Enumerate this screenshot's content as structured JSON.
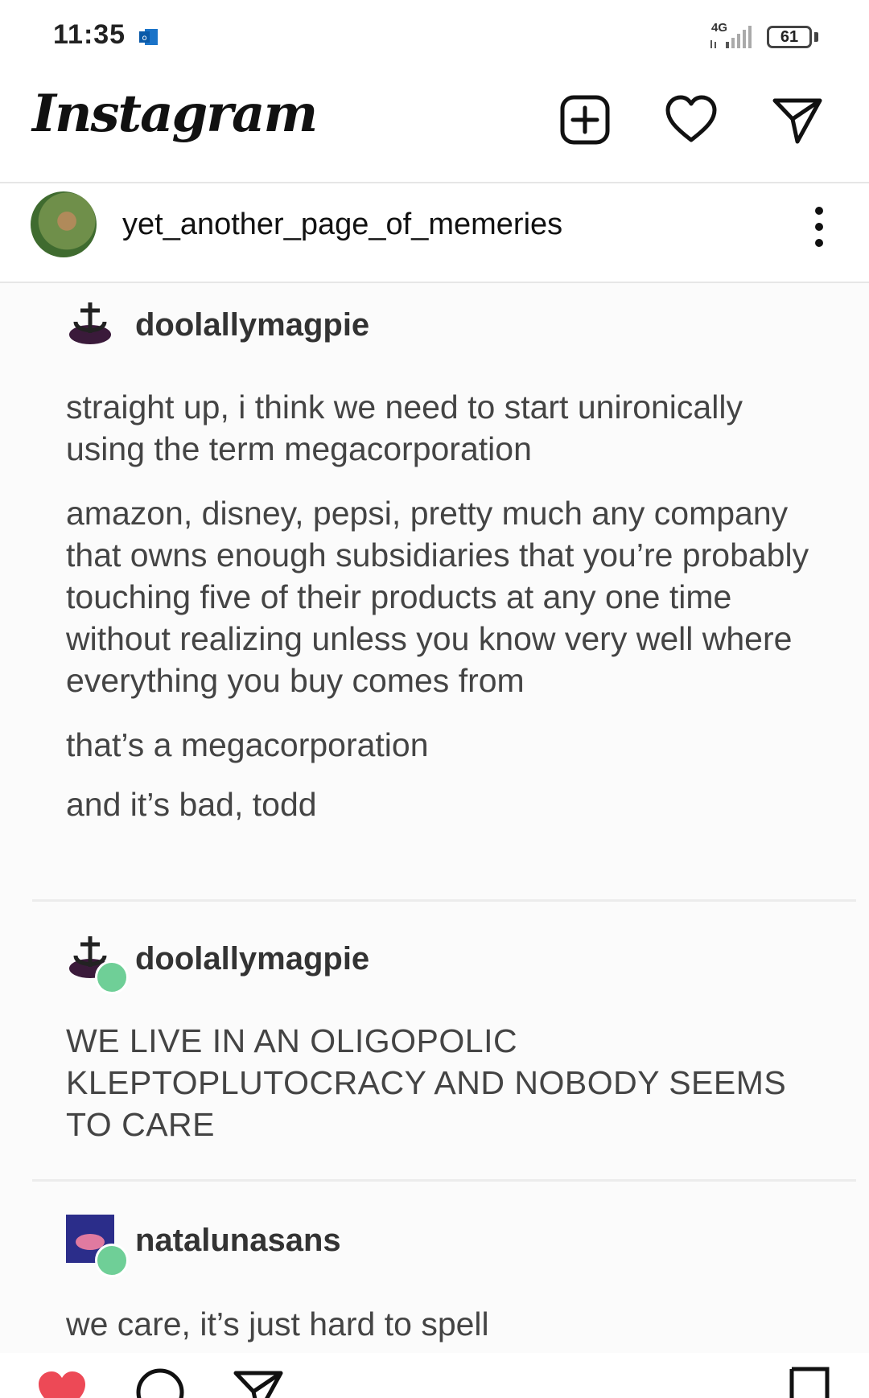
{
  "status": {
    "time": "11:35",
    "network": "4G",
    "battery": "61"
  },
  "header": {
    "logo": "Instagram",
    "icons": [
      "add-post-icon",
      "heart-icon",
      "direct-message-icon"
    ]
  },
  "post": {
    "username": "yet_another_page_of_memeries",
    "tumblr_blocks": [
      {
        "username": "doolallymagpie",
        "paragraphs": [
          "straight up, i think we need to start unironically using the term megacorporation",
          "amazon, disney, pepsi, pretty much any company that owns enough subsidiaries that you’re probably touching five of their products at any one time without realizing unless you know very well where everything you buy comes from",
          "that’s a megacorporation",
          "and it’s bad, todd"
        ]
      },
      {
        "username": "doolallymagpie",
        "paragraphs": [
          "WE LIVE IN AN OLIGOPOLIC KLEPTOPLUTOCRACY AND NOBODY SEEMS TO CARE"
        ]
      },
      {
        "username": "natalunasans",
        "paragraphs": [
          "we care, it’s just hard to spell"
        ]
      }
    ]
  },
  "actions": {
    "icons": [
      "like-icon",
      "comment-icon",
      "share-icon",
      "save-icon"
    ],
    "like_color": "#ed4956"
  }
}
